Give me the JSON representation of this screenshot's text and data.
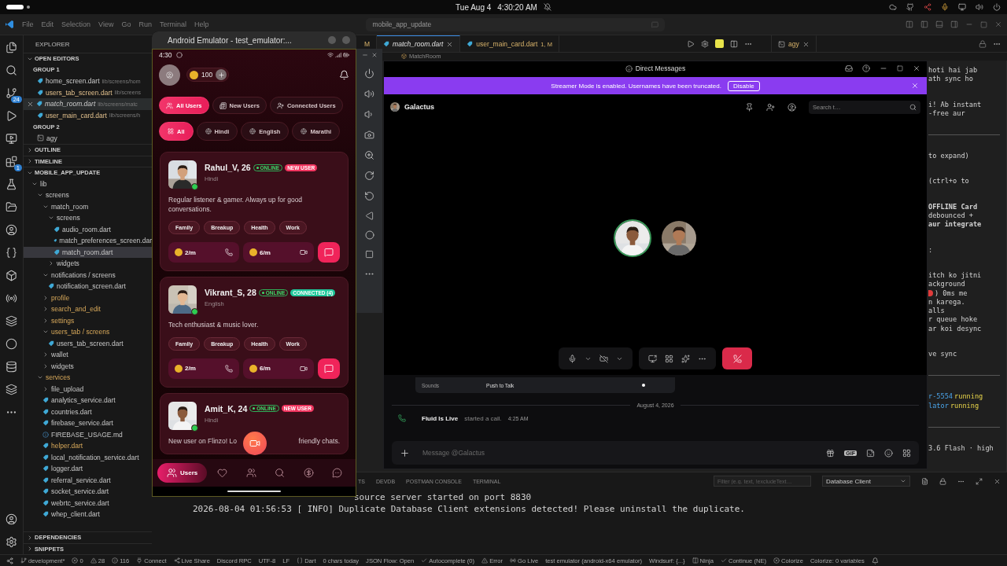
{
  "top_bar": {
    "date": "Tue Aug 4",
    "time": "4:30:20 AM"
  },
  "menu": [
    "File",
    "Edit",
    "Selection",
    "View",
    "Go",
    "Run",
    "Terminal",
    "Help"
  ],
  "command_center": "mobile_app_update",
  "activity_badges": [
    "24",
    "1"
  ],
  "explorer": {
    "title": "EXPLORER",
    "open_editors": {
      "label": "OPEN EDITORS",
      "expanded": true,
      "groups": [
        {
          "label": "GROUP 1",
          "files": [
            {
              "name": "home_screen.dart",
              "path": "lib/screens/hom",
              "kind": "dart",
              "selected": false,
              "modified": false
            },
            {
              "name": "users_tab_screen.dart",
              "path": "lib/screens",
              "kind": "dart",
              "selected": false,
              "modified": true
            },
            {
              "name": "match_room.dart",
              "path": "lib/screens/matc",
              "kind": "dart",
              "selected": true,
              "modified": false
            },
            {
              "name": "user_main_card.dart",
              "path": "lib/screens/h",
              "kind": "dart",
              "selected": false,
              "modified": true
            }
          ]
        },
        {
          "label": "GROUP 2",
          "files": [
            {
              "name": "agy",
              "kind": "terminal",
              "selected": false,
              "modified": false
            }
          ]
        }
      ]
    },
    "sections_before": [
      {
        "label": "OUTLINE",
        "expanded": false
      },
      {
        "label": "TIMELINE",
        "expanded": false
      }
    ],
    "project": {
      "label": "MOBILE_APP_UPDATE",
      "expanded": true,
      "tree": [
        {
          "name": "lib",
          "kind": "folder",
          "expanded": true,
          "modified": false,
          "selected": false,
          "children": [
            {
              "name": "screens",
              "kind": "folder",
              "expanded": true,
              "modified": false,
              "selected": false,
              "children": [
                {
                  "name": "match_room",
                  "kind": "folder",
                  "expanded": true,
                  "modified": false,
                  "selected": false,
                  "children": [
                    {
                      "name": "screens",
                      "kind": "folder",
                      "expanded": true,
                      "modified": false,
                      "selected": false,
                      "children": [
                        {
                          "name": "audio_room.dart",
                          "kind": "dart",
                          "modified": false,
                          "selected": false
                        },
                        {
                          "name": "match_preferences_screen.dar",
                          "kind": "dart",
                          "modified": false,
                          "selected": false
                        },
                        {
                          "name": "match_room.dart",
                          "kind": "dart",
                          "modified": false,
                          "selected": true
                        }
                      ]
                    },
                    {
                      "name": "widgets",
                      "kind": "folder",
                      "expanded": false,
                      "modified": false,
                      "selected": false
                    }
                  ]
                },
                {
                  "name": "notifications / screens",
                  "kind": "folder",
                  "expanded": true,
                  "modified": false,
                  "selected": false,
                  "children": [
                    {
                      "name": "notification_screen.dart",
                      "kind": "dart",
                      "modified": false,
                      "selected": false
                    }
                  ]
                },
                {
                  "name": "profile",
                  "kind": "folder",
                  "expanded": false,
                  "modified": true,
                  "selected": false
                },
                {
                  "name": "search_and_edit",
                  "kind": "folder",
                  "expanded": false,
                  "modified": true,
                  "selected": false
                },
                {
                  "name": "settings",
                  "kind": "folder",
                  "expanded": false,
                  "modified": true,
                  "selected": false
                },
                {
                  "name": "users_tab / screens",
                  "kind": "folder",
                  "expanded": true,
                  "modified": true,
                  "selected": false,
                  "children": [
                    {
                      "name": "users_tab_screen.dart",
                      "kind": "dart",
                      "modified": false,
                      "selected": false
                    }
                  ]
                },
                {
                  "name": "wallet",
                  "kind": "folder",
                  "expanded": false,
                  "modified": false,
                  "selected": false
                },
                {
                  "name": "widgets",
                  "kind": "folder",
                  "expanded": false,
                  "modified": false,
                  "selected": false
                }
              ]
            },
            {
              "name": "services",
              "kind": "folder",
              "expanded": true,
              "modified": true,
              "selected": false,
              "children": [
                {
                  "name": "file_upload",
                  "kind": "folder",
                  "expanded": false,
                  "modified": false,
                  "selected": false
                },
                {
                  "name": "analytics_service.dart",
                  "kind": "dart",
                  "modified": false,
                  "selected": false
                },
                {
                  "name": "countries.dart",
                  "kind": "dart",
                  "modified": false,
                  "selected": false
                },
                {
                  "name": "firebase_service.dart",
                  "kind": "dart",
                  "modified": false,
                  "selected": false
                },
                {
                  "name": "FIREBASE_USAGE.md",
                  "kind": "markdown",
                  "modified": false,
                  "selected": false
                },
                {
                  "name": "helper.dart",
                  "kind": "dart",
                  "modified": true,
                  "selected": false
                },
                {
                  "name": "local_notification_service.dart",
                  "kind": "dart",
                  "modified": false,
                  "selected": false
                },
                {
                  "name": "logger.dart",
                  "kind": "dart",
                  "modified": false,
                  "selected": false
                },
                {
                  "name": "referral_service.dart",
                  "kind": "dart",
                  "modified": false,
                  "selected": false
                },
                {
                  "name": "socket_service.dart",
                  "kind": "dart",
                  "modified": false,
                  "selected": false
                },
                {
                  "name": "webrtc_service.dart",
                  "kind": "dart",
                  "modified": false,
                  "selected": false
                },
                {
                  "name": "whep_client.dart",
                  "kind": "dart",
                  "modified": false,
                  "selected": false
                }
              ]
            }
          ]
        }
      ]
    },
    "sections_after": [
      {
        "label": "DEPENDENCIES",
        "expanded": false
      },
      {
        "label": "SNIPPETS",
        "expanded": false
      }
    ]
  },
  "editor_tabs": [
    {
      "label": "M",
      "selected": false
    },
    {
      "label": "match_room.dart",
      "selected": true
    },
    {
      "label": "user_main_card.dart",
      "badge": "1, M",
      "selected": false
    }
  ],
  "side_tab": "agy",
  "breadcrumb": "MatchRoom",
  "code_view": [
    {
      "kind": "para",
      "lines": [
        {
          "kind": "plain",
          "text": "hoti hai jab"
        },
        {
          "kind": "plain",
          "text": "ath sync ho"
        }
      ]
    },
    {
      "kind": "para",
      "lines": [
        {
          "kind": "plain",
          "text": "i! Ab instant"
        },
        {
          "kind": "plain",
          "text": "-free aur"
        }
      ]
    },
    {
      "kind": "rule"
    },
    {
      "kind": "para",
      "lines": [
        {
          "kind": "plain",
          "text": "to expand)"
        }
      ]
    },
    {
      "kind": "para",
      "lines": [
        {
          "kind": "plain",
          "text": "(ctrl+o to"
        }
      ]
    },
    {
      "kind": "para",
      "lines": [
        {
          "kind": "bold",
          "text": "OFFLINE Card"
        },
        {
          "kind": "plain",
          "text": "debounced +"
        },
        {
          "kind": "bold",
          "text": "aur integrate"
        }
      ]
    },
    {
      "kind": "para",
      "lines": [
        {
          "kind": "plain",
          "text": ":"
        }
      ]
    },
    {
      "kind": "para",
      "lines": [
        {
          "kind": "plain",
          "text": "itch ko jitni"
        },
        {
          "kind": "plain",
          "text": "ackground"
        },
        {
          "kind": "flagged",
          "text": ") 0ms me"
        },
        {
          "kind": "plain",
          "text": "n karega."
        },
        {
          "kind": "plain",
          "text": "alls"
        },
        {
          "kind": "plain",
          "text": "r queue hoke"
        },
        {
          "kind": "plain",
          "text": "ar koi desync"
        }
      ]
    },
    {
      "kind": "para",
      "lines": [
        {
          "kind": "plain",
          "text": "ve sync"
        }
      ]
    },
    {
      "kind": "rule"
    },
    {
      "kind": "status",
      "lines": [
        {
          "name": "r-5554",
          "state": "running"
        },
        {
          "name": "lator",
          "state": "running"
        }
      ]
    },
    {
      "kind": "rule"
    },
    {
      "kind": "para",
      "lines": [
        {
          "kind": "plain",
          "text": "3.6 Flash · high"
        }
      ]
    }
  ],
  "panel": {
    "tabs": [
      "TS",
      "DEVDB",
      "POSTMAN CONSOLE",
      "TERMINAL"
    ],
    "filter_placeholder": "Filter (e.g. text, !excludeText…",
    "channel": "Database Client",
    "output": [
      {
        "indent": true,
        "text": "source server started on port 8830"
      },
      {
        "indent": false,
        "text": "2026-08-04 01:56:53 [ INFO] Duplicate Database Client extensions detected! Please uninstall the duplicate."
      }
    ]
  },
  "status_bar": [
    "development*",
    "0",
    "28",
    "116",
    "Connect",
    "Live Share",
    "Discord RPC",
    "UTF-8",
    "LF",
    "Dart",
    "0 chars today",
    "JSON Flow: Open",
    "Autocomplete (0)",
    "Error",
    "Go Live",
    "test emulator (android-x64 emulator)",
    "Windsurf: {...}",
    "Ninja",
    "Continue (NE)",
    "Colorize",
    "Colorize: 0 variables"
  ],
  "emulator": {
    "title": "Android Emulator - test_emulator:...",
    "status_time": "4:30",
    "coins": "100",
    "user_tabs": [
      {
        "label": "All Users",
        "selected": true
      },
      {
        "label": "New Users",
        "selected": false
      },
      {
        "label": "Connected Users",
        "selected": false
      }
    ],
    "languages": [
      {
        "label": "All",
        "selected": true
      },
      {
        "label": "Hindi",
        "selected": false
      },
      {
        "label": "English",
        "selected": false
      },
      {
        "label": "Marathi",
        "selected": false
      }
    ],
    "users": [
      {
        "name": "Rahul_V, 26",
        "online": true,
        "status": "ONLINE",
        "tag": {
          "kind": "new",
          "label": "NEW USER"
        },
        "language": "Hindi",
        "bio": [
          "Regular listener & gamer. Always up for good conversations."
        ],
        "interests": [
          "Family",
          "Breakup",
          "Health",
          "Work"
        ],
        "prices": [
          "2/m",
          "6/m"
        ]
      },
      {
        "name": "Vikrant_S, 28",
        "online": true,
        "status": "ONLINE",
        "tag": {
          "kind": "connected",
          "label": "CONNECTED (4)"
        },
        "language": "English",
        "bio": [
          "Tech enthusiast & music lover."
        ],
        "interests": [
          "Family",
          "Breakup",
          "Health",
          "Work"
        ],
        "prices": [
          "2/m",
          "6/m"
        ]
      },
      {
        "name": "Amit_K, 24",
        "online": true,
        "status": "ONLINE",
        "tag": {
          "kind": "new",
          "label": "NEW USER"
        },
        "language": "Hindi",
        "bio": [
          "New user on Flinzo! Lo",
          "friendly chats."
        ]
      }
    ],
    "nav": [
      {
        "label": "Users",
        "selected": true
      },
      {
        "selected": false
      },
      {
        "selected": false
      },
      {
        "selected": false
      },
      {
        "selected": false
      },
      {
        "selected": false
      }
    ]
  },
  "discord": {
    "title": "Direct Messages",
    "banner": {
      "text": "Streamer Mode is enabled. Usernames have been truncated.",
      "action": "Disable"
    },
    "channel": "Galactus",
    "search_placeholder": "Search t…",
    "popup": {
      "left": "Sounds",
      "label": "Push to Talk"
    },
    "date": "August 4, 2026",
    "message": {
      "author": "Fluid Is Live",
      "text": "started a call.",
      "time": "4:25 AM"
    },
    "input_placeholder": "Message @Galactus",
    "gif": "GIF"
  }
}
